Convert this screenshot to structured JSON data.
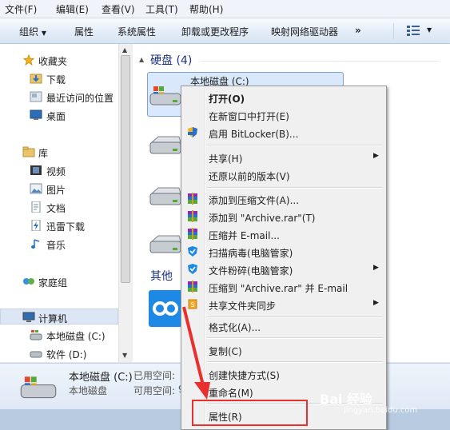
{
  "menubar": {
    "file": "文件(F)",
    "edit": "编辑(E)",
    "view": "查看(V)",
    "tools": "工具(T)",
    "help": "帮助(H)"
  },
  "toolbar": {
    "organize": "组织",
    "properties": "属性",
    "system_properties": "系统属性",
    "uninstall": "卸载或更改程序",
    "map_drive": "映射网络驱动器",
    "more": "»"
  },
  "nav": {
    "favorites": "收藏夹",
    "downloads": "下载",
    "recent": "最近访问的位置",
    "desktop": "桌面",
    "libraries": "库",
    "videos": "视频",
    "pictures": "图片",
    "documents": "文档",
    "thunder": "迅雷下载",
    "music": "音乐",
    "homegroup": "家庭组",
    "computer": "计算机",
    "local_c": "本地磁盘 (C:)",
    "soft_d": "软件 (D:)"
  },
  "content": {
    "hdd_group": "硬盘 (4)",
    "local_c": "本地磁盘 (C:)",
    "other_group": "其他"
  },
  "details": {
    "name": "本地磁盘 (C:)",
    "type": "本地磁盘",
    "used_label": "已用空间:",
    "free_label": "可用空间:",
    "used_value_trunc": "",
    "free_value_trunc": "9"
  },
  "context_menu": {
    "items": [
      {
        "label": "打开(O)",
        "bold": true
      },
      {
        "label": "在新窗口中打开(E)"
      },
      {
        "label": "启用 BitLocker(B)..."
      },
      {
        "label": "共享(H)",
        "submenu": true
      },
      {
        "label": "还原以前的版本(V)"
      },
      {
        "label": "添加到压缩文件(A)..."
      },
      {
        "label": "添加到 \"Archive.rar\"(T)"
      },
      {
        "label": "压缩并 E-mail..."
      },
      {
        "label": "扫描病毒(电脑管家)"
      },
      {
        "label": "文件粉碎(电脑管家)",
        "submenu": true
      },
      {
        "label": "压缩到 \"Archive.rar\" 并 E-mail"
      },
      {
        "label": "共享文件夹同步",
        "submenu": true
      },
      {
        "label": "格式化(A)..."
      },
      {
        "label": "复制(C)"
      },
      {
        "label": "创建快捷方式(S)"
      },
      {
        "label": "重命名(M)"
      },
      {
        "label": "属性(R)"
      }
    ],
    "arrow_glyph": "▶"
  },
  "watermark": {
    "brand": "Bai 经验",
    "url": "jingyan.baidu.com"
  },
  "colors": {
    "highlight_red": "#e8302e",
    "selection_blue": "#d9e8fb",
    "group_header": "#1e3287"
  }
}
